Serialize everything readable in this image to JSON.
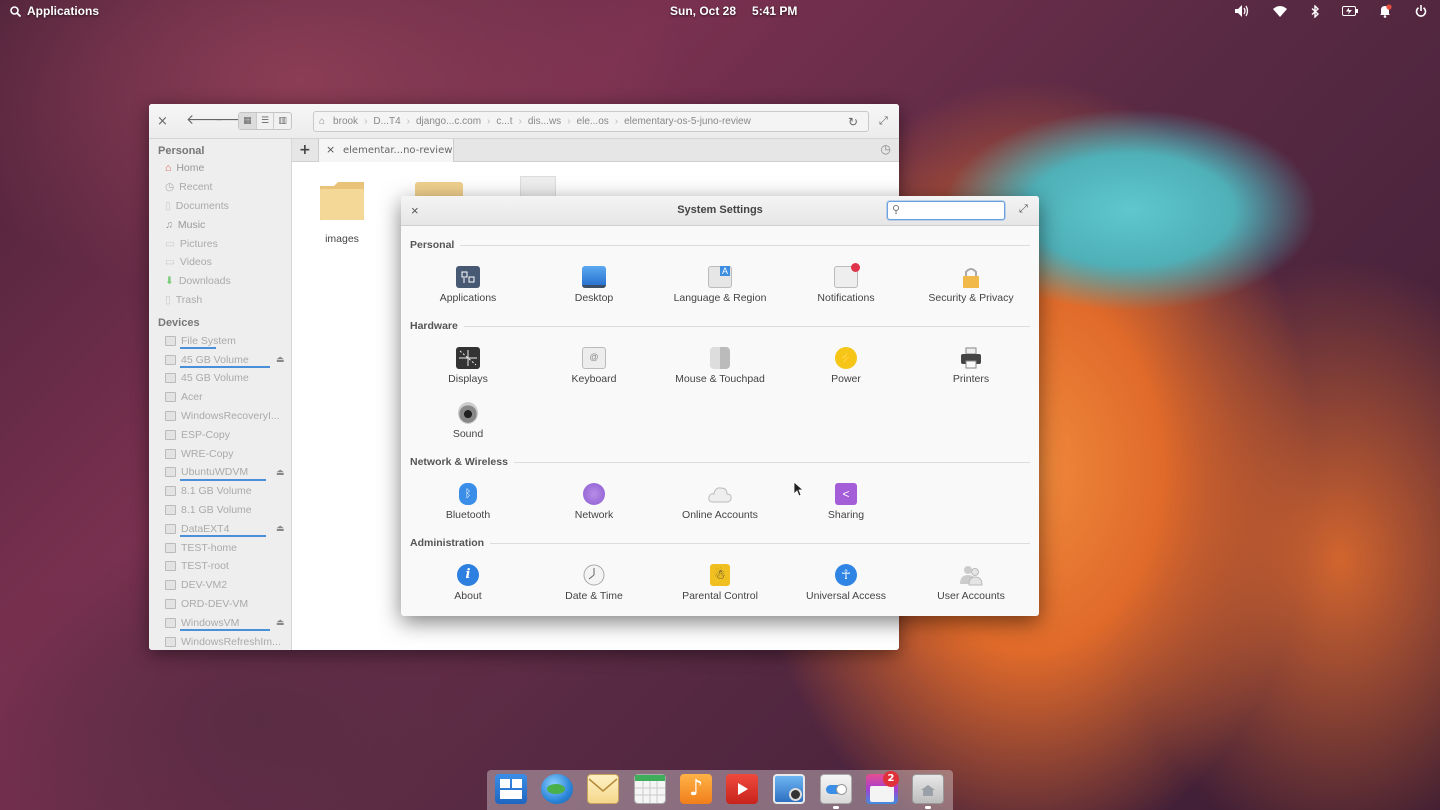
{
  "panel": {
    "apps_label": "Applications",
    "date": "Sun, Oct 28",
    "time": "5:41 PM",
    "indicators": [
      "volume-icon",
      "wifi-icon",
      "bluetooth-icon",
      "battery-icon",
      "notifications-icon",
      "power-icon"
    ]
  },
  "files": {
    "breadcrumbs": [
      "brook",
      "D...T4",
      "django...c.com",
      "c...t",
      "dis...ws",
      "ele...os",
      "elementary-os-5-juno-review"
    ],
    "tab_label": "elementar...no-review",
    "folder_label": "images",
    "sidebar": {
      "personal_title": "Personal",
      "personal": [
        "Home",
        "Recent",
        "Documents",
        "Music",
        "Pictures",
        "Videos",
        "Downloads",
        "Trash"
      ],
      "devices_title": "Devices",
      "devices": [
        "File System",
        "45 GB Volume",
        "45 GB Volume",
        "Acer",
        "WindowsRecoveryI...",
        "ESP-Copy",
        "WRE-Copy",
        "UbuntuWDVM",
        "8.1 GB Volume",
        "8.1 GB Volume",
        "DataEXT4",
        "TEST-home",
        "TEST-root",
        "DEV-VM2",
        "ORD-DEV-VM",
        "WindowsVM",
        "WindowsRefreshIm..."
      ]
    }
  },
  "settings": {
    "title": "System Settings",
    "search_placeholder": "",
    "categories": {
      "personal": "Personal",
      "hardware": "Hardware",
      "network": "Network & Wireless",
      "admin": "Administration"
    },
    "personal": [
      "Applications",
      "Desktop",
      "Language & Region",
      "Notifications",
      "Security & Privacy"
    ],
    "hardware": [
      "Displays",
      "Keyboard",
      "Mouse & Touchpad",
      "Power",
      "Printers",
      "Sound"
    ],
    "network": [
      "Bluetooth",
      "Network",
      "Online Accounts",
      "Sharing"
    ],
    "admin": [
      "About",
      "Date & Time",
      "Parental Control",
      "Universal Access",
      "User Accounts"
    ]
  },
  "dock": {
    "apps": [
      "multitasking-view-icon",
      "web-browser-icon",
      "mail-icon",
      "calendar-icon",
      "music-icon",
      "videos-icon",
      "photos-icon",
      "system-settings-icon",
      "appcenter-icon",
      "files-icon"
    ],
    "appcenter_badge": "2"
  }
}
